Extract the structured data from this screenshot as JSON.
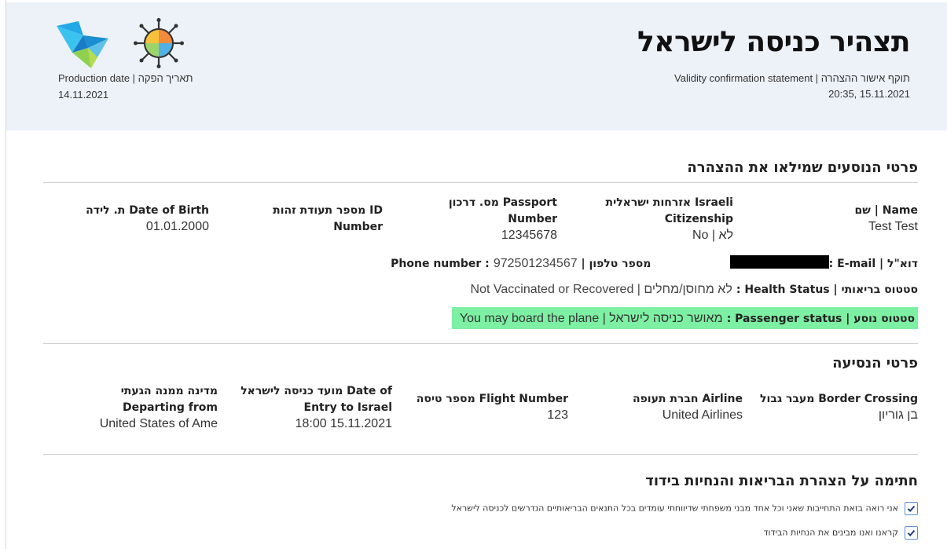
{
  "header": {
    "title": "תצהיר כניסה לישראל",
    "validity_label": "Validity confirmation statement | תוקף אישור ההצהרה",
    "validity_value": "20:35, 15.11.2021",
    "production_label": "Production date | תאריך הפקה",
    "production_value": "14.11.2021",
    "logos": [
      "star-logo",
      "virus-logo"
    ]
  },
  "passengers": {
    "section_title": "פרטי הנוסעים שמילאו את ההצהרה",
    "name": {
      "label": "שם | Name",
      "value": "Test Test"
    },
    "citizenship": {
      "label_1": "אזרחות ישראלית Israeli",
      "label_2": "Citizenship",
      "value": "No | לא"
    },
    "passport": {
      "label_1": "מס. דרכון Passport",
      "label_2": "Number",
      "value": "12345678"
    },
    "id_number": {
      "label_1": "מספר תעודת זהות ID",
      "label_2": "Number",
      "value": ""
    },
    "dob": {
      "label": "ת. לידה Date of Birth",
      "value": "01.01.2000"
    },
    "email": {
      "label": "דוא\"ל | E-mail :",
      "value": ""
    },
    "phone": {
      "label": "מספר טלפון | Phone number :",
      "value": "972501234567"
    },
    "health": {
      "label": "סטטוס בריאותי | Health Status :",
      "value": "לא מחוסן/מחלים | Not Vaccinated or Recovered"
    },
    "passenger_status": {
      "label": "סטטוס נוסע | Passenger status :",
      "value": "מאושר כניסה לישראל | You may board the plane"
    }
  },
  "trip": {
    "section_title": "פרטי הנסיעה",
    "border": {
      "label": "מעבר גבול Border Crossing",
      "value": "בן גוריון"
    },
    "airline": {
      "label": "חברת תעופה Airline",
      "value": "United Airlines"
    },
    "flight": {
      "label": "מספר טיסה Flight Number",
      "value": "123"
    },
    "entry": {
      "label_1": "מועד כניסה לישראל Date of",
      "label_2": "Entry to Israel",
      "value": "18:00 15.11.2021"
    },
    "departing": {
      "label_1": "מדינה ממנה הגעתי",
      "label_2": "Departing from",
      "value": "United States of Ame"
    }
  },
  "declaration": {
    "section_title": "חתימה על הצהרת הבריאות והנחיות בידוד",
    "items": [
      {
        "text": "אני רואה בזאת התחייבות שאני וכל אחד מבני משפחתי שדיווחתי עומדים בכל התנאים הבריאותיים הנדרשים לכניסה לישראל",
        "checked": true
      },
      {
        "text": "קראנו ואנו מבינים את הנחיות הבידוד",
        "checked": true
      }
    ]
  },
  "colors": {
    "header_bg": "#edf2f9",
    "status_green": "#7ef0a4",
    "checkbox_border": "#5a8dd6"
  }
}
